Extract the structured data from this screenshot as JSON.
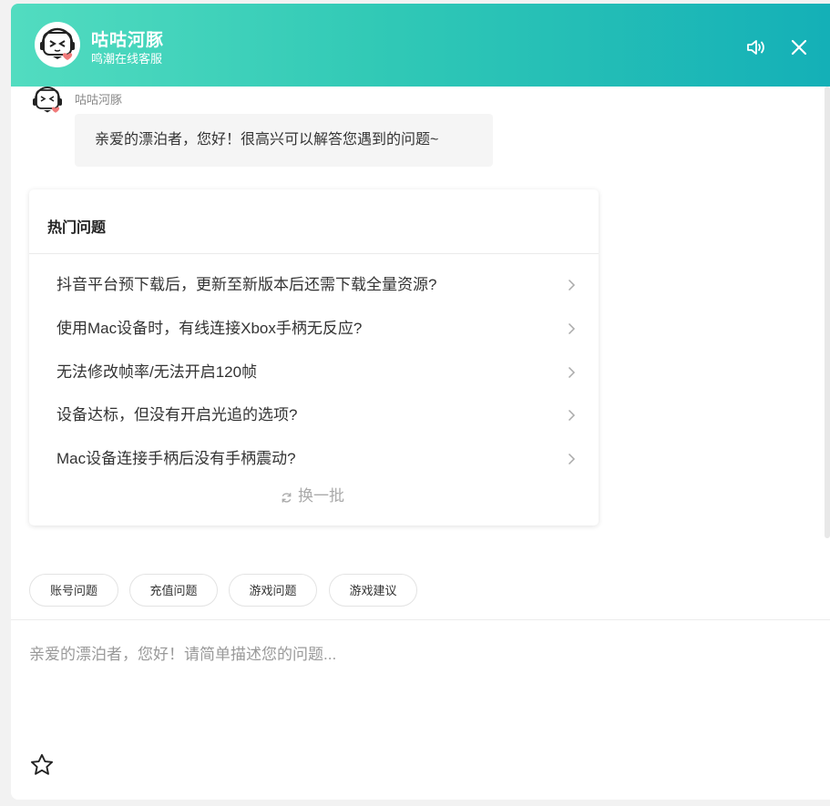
{
  "header": {
    "title": "咕咕河豚",
    "subtitle": "鸣潮在线客服",
    "speaker_icon": "speaker-icon",
    "close_icon": "close-icon",
    "gradient": [
      "#52dcc0",
      "#14b0b7"
    ]
  },
  "chat": {
    "bot_name": "咕咕河豚",
    "greeting": "亲爱的漂泊者，您好！很高兴可以解答您遇到的问题~"
  },
  "faq": {
    "title": "热门问题",
    "items": [
      "抖音平台预下载后，更新至新版本后还需下载全量资源?",
      "使用Mac设备时，有线连接Xbox手柄无反应?",
      "无法修改帧率/无法开启120帧",
      "设备达标，但没有开启光追的选项?",
      "Mac设备连接手柄后没有手柄震动?"
    ],
    "refresh_label": "换一批"
  },
  "quick_tags": [
    "账号问题",
    "充值问题",
    "游戏问题",
    "游戏建议"
  ],
  "input": {
    "placeholder": "亲爱的漂泊者，您好！请简单描述您的问题..."
  },
  "colors": {
    "accent": "#31c9b6",
    "text": "#333333",
    "muted": "#999999"
  }
}
